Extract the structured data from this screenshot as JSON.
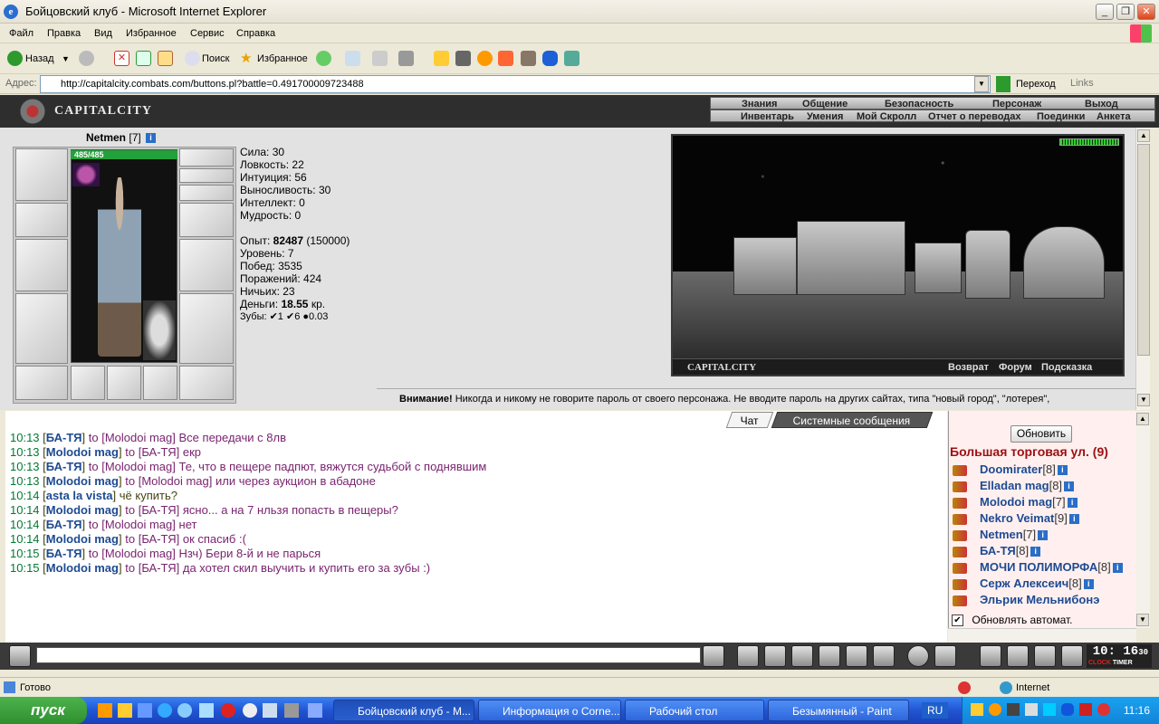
{
  "window": {
    "title": "Бойцовский клуб - Microsoft Internet Explorer"
  },
  "menu": [
    "Файл",
    "Правка",
    "Вид",
    "Избранное",
    "Сервис",
    "Справка"
  ],
  "toolbar": {
    "back": "Назад",
    "search": "Поиск",
    "favorites": "Избранное"
  },
  "address": {
    "label": "Адрес:",
    "url": "http://capitalcity.combats.com/buttons.pl?battle=0.491700009723488",
    "go": "Переход",
    "links": "Links"
  },
  "game": {
    "logo": "CAPITALCITY",
    "nav_top": [
      "Знания",
      "Общение",
      "Безопасность",
      "Персонаж",
      "Выход"
    ],
    "nav_bottom": [
      "Инвентарь",
      "Умения",
      "Мой Скролл",
      "Отчет о переводах",
      "Поединки",
      "Анкета"
    ],
    "character": {
      "name": "Netmen",
      "level": "[7]",
      "hp": "485/485"
    },
    "stats": [
      {
        "label": "Сила:",
        "value": "30"
      },
      {
        "label": "Ловкость:",
        "value": "22"
      },
      {
        "label": "Интуиция:",
        "value": "56"
      },
      {
        "label": "Выносливость:",
        "value": "30"
      },
      {
        "label": "Интеллект:",
        "value": "0"
      },
      {
        "label": "Мудрость:",
        "value": "0"
      }
    ],
    "records": {
      "exp_label": "Опыт:",
      "exp": "82487",
      "exp_next": "(150000)",
      "level_line": "Уровень: 7",
      "wins_line": "Побед: 3535",
      "losses_line": "Поражений: 424",
      "draws_line": "Ничьих: 23",
      "money_label": "Деньги:",
      "money": "18.55",
      "money_unit": "кр.",
      "teeth": "Зубы: ✔1 ✔6 ●0.03"
    },
    "scene": {
      "caption": "CAPITALCITY",
      "links": [
        "Возврат",
        "Форум",
        "Подсказка"
      ]
    },
    "warning": {
      "bold": "Внимание!",
      "text": " Никогда и никому не говорите пароль от своего персонажа. Не вводите пароль на других сайтах, типа \"новый город\", \"лотерея\","
    }
  },
  "chat": {
    "tabs": [
      "Чат",
      "Системные сообщения"
    ],
    "lines": [
      {
        "time": "10:13",
        "from": "БА-ТЯ",
        "to": "Molodoi mag",
        "text": "Все передачи с 8лв"
      },
      {
        "time": "10:13",
        "from": "Molodoi mag",
        "to": "БА-ТЯ",
        "text": "екр"
      },
      {
        "time": "10:13",
        "from": "БА-ТЯ",
        "to": "Molodoi mag",
        "text": "Те, что в пещере падпют, вяжутся судьбой с поднявшим"
      },
      {
        "time": "10:13",
        "from": "Molodoi mag",
        "to": "Molodoi mag",
        "text": "или через аукцион в абадоне"
      },
      {
        "time": "10:14",
        "from": "asta la vista",
        "to": "",
        "text": "чё купить?"
      },
      {
        "time": "10:14",
        "from": "Molodoi mag",
        "to": "БА-ТЯ",
        "text": "ясно... а на 7 нльзя попасть в пещеры?"
      },
      {
        "time": "10:14",
        "from": "БА-ТЯ",
        "to": "Molodoi mag",
        "text": "нет"
      },
      {
        "time": "10:14",
        "from": "Molodoi mag",
        "to": "БА-ТЯ",
        "text": "ок спасиб :("
      },
      {
        "time": "10:15",
        "from": "БА-ТЯ",
        "to": "Molodoi mag",
        "text": "Нзч) Бери 8-й и не парься"
      },
      {
        "time": "10:15",
        "from": "Molodoi mag",
        "to": "БА-ТЯ",
        "text": "да хотел скил выучить и купить его за зубы :)"
      }
    ]
  },
  "users": {
    "refresh": "Обновить",
    "room": "Большая торговая ул. (9)",
    "list": [
      {
        "name": "Doomirater",
        "level": "[8]"
      },
      {
        "name": "Elladan mag",
        "level": "[8]"
      },
      {
        "name": "Molodoi mag",
        "level": "[7]"
      },
      {
        "name": "Nekro Veimat",
        "level": "[9]"
      },
      {
        "name": "Netmen",
        "level": "[7]"
      },
      {
        "name": "БА-ТЯ",
        "level": "[8]"
      },
      {
        "name": "МОЧИ ПОЛИМОРФА",
        "level": "[8]"
      },
      {
        "name": "Серж Алексеич",
        "level": "[8]"
      },
      {
        "name": "Эльрик Мельнибонэ",
        "level": ""
      }
    ],
    "auto": "Обновлять автомат."
  },
  "clock": {
    "time": "10: 16",
    "seconds": "30",
    "label1": "CLOCK",
    "label2": "TIMER"
  },
  "status": {
    "text": "Готово",
    "zone": "Internet"
  },
  "taskbar": {
    "start": "пуск",
    "tasks": [
      "Бойцовский клуб - M...",
      "Информация о Corne...",
      "Рабочий стол",
      "Безымянный - Paint"
    ],
    "lang": "RU",
    "time": "11:16"
  }
}
